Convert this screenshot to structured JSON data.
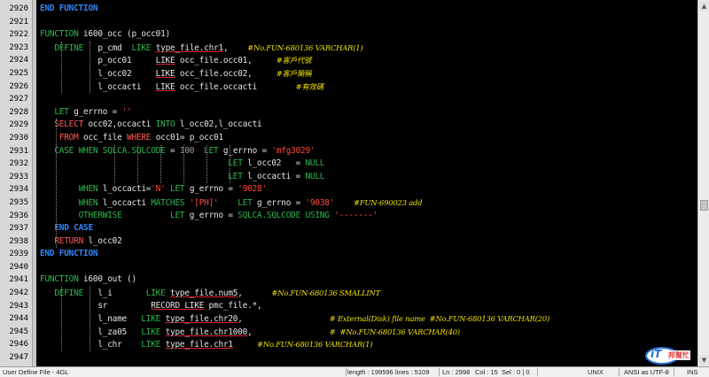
{
  "lines": [
    {
      "n": "2920",
      "segs": [
        {
          "c": "kw",
          "t": "END FUNCTION"
        }
      ]
    },
    {
      "n": "2921",
      "segs": []
    },
    {
      "n": "2922",
      "segs": [
        {
          "c": "kw2",
          "t": "FUNCTION "
        },
        {
          "c": "id",
          "t": "i600_occ (p_occ01)"
        }
      ]
    },
    {
      "n": "2923",
      "segs": [
        {
          "c": "id",
          "t": "   "
        },
        {
          "c": "kw2",
          "t": "DEFINE"
        },
        {
          "c": "id",
          "t": "   p_cmd  "
        },
        {
          "c": "kw2",
          "t": "LIKE "
        },
        {
          "c": "ul",
          "t": "type_file.chr1"
        },
        {
          "c": "id",
          "t": ",    "
        },
        {
          "c": "cm",
          "t": "#No.FUN-680136 VARCHAR(1)"
        }
      ]
    },
    {
      "n": "2924",
      "segs": [
        {
          "c": "id",
          "t": "            p_occ01     "
        },
        {
          "c": "ul",
          "t": "LIKE"
        },
        {
          "c": "id",
          "t": " occ_file.occ01,     "
        },
        {
          "c": "cm",
          "t": "#客戶代號"
        }
      ]
    },
    {
      "n": "2925",
      "segs": [
        {
          "c": "id",
          "t": "            l_occ02     "
        },
        {
          "c": "ul",
          "t": "LIKE"
        },
        {
          "c": "id",
          "t": " occ_file.occ02,     "
        },
        {
          "c": "cm",
          "t": "#客戶簡稱"
        }
      ]
    },
    {
      "n": "2926",
      "segs": [
        {
          "c": "id",
          "t": "            l_occacti   "
        },
        {
          "c": "ul",
          "t": "LIKE"
        },
        {
          "c": "id",
          "t": " occ_file.occacti        "
        },
        {
          "c": "cm",
          "t": "#有效碼"
        }
      ]
    },
    {
      "n": "2927",
      "segs": []
    },
    {
      "n": "2928",
      "segs": [
        {
          "c": "id",
          "t": "   "
        },
        {
          "c": "kw2",
          "t": "LET"
        },
        {
          "c": "id",
          "t": " g_errno = "
        },
        {
          "c": "str",
          "t": "''"
        }
      ]
    },
    {
      "n": "2929",
      "segs": [
        {
          "c": "id",
          "t": "   "
        },
        {
          "c": "kw3",
          "t": "SELECT"
        },
        {
          "c": "id",
          "t": " occ02,occacti "
        },
        {
          "c": "kw2",
          "t": "INTO"
        },
        {
          "c": "id",
          "t": " l_occ02,l_occacti"
        }
      ]
    },
    {
      "n": "2930",
      "segs": [
        {
          "c": "id",
          "t": "    "
        },
        {
          "c": "kw3",
          "t": "FROM"
        },
        {
          "c": "id",
          "t": " occ_file "
        },
        {
          "c": "kw3",
          "t": "WHERE"
        },
        {
          "c": "id",
          "t": " occ01= p_occ01"
        }
      ]
    },
    {
      "n": "2931",
      "segs": [
        {
          "c": "id",
          "t": "   "
        },
        {
          "c": "kw2",
          "t": "CASE WHEN SQLCA.SQLCODE"
        },
        {
          "c": "id",
          "t": " = "
        },
        {
          "c": "num",
          "t": "100"
        },
        {
          "c": "id",
          "t": "  "
        },
        {
          "c": "kw2",
          "t": "LET"
        },
        {
          "c": "id",
          "t": " g_errno = "
        },
        {
          "c": "str",
          "t": "'mfg3029'"
        }
      ]
    },
    {
      "n": "2932",
      "segs": [
        {
          "c": "id",
          "t": "                                       "
        },
        {
          "c": "kw2",
          "t": "LET"
        },
        {
          "c": "id",
          "t": " l_occ02   = "
        },
        {
          "c": "kw2",
          "t": "NULL"
        }
      ]
    },
    {
      "n": "2933",
      "segs": [
        {
          "c": "id",
          "t": "                                       "
        },
        {
          "c": "kw2",
          "t": "LET"
        },
        {
          "c": "id",
          "t": " l_occacti = "
        },
        {
          "c": "kw2",
          "t": "NULL"
        }
      ]
    },
    {
      "n": "2934",
      "segs": [
        {
          "c": "id",
          "t": "        "
        },
        {
          "c": "kw2",
          "t": "WHEN"
        },
        {
          "c": "id",
          "t": " l_occacti="
        },
        {
          "c": "str",
          "t": "'N'"
        },
        {
          "c": "id",
          "t": " "
        },
        {
          "c": "kw2",
          "t": "LET"
        },
        {
          "c": "id",
          "t": " g_errno = "
        },
        {
          "c": "str",
          "t": "'9028'"
        }
      ]
    },
    {
      "n": "2935",
      "segs": [
        {
          "c": "id",
          "t": "        "
        },
        {
          "c": "kw2",
          "t": "WHEN"
        },
        {
          "c": "id",
          "t": " l_occacti "
        },
        {
          "c": "kw2",
          "t": "MATCHES"
        },
        {
          "c": "id",
          "t": " "
        },
        {
          "c": "str",
          "t": "'[PH]'"
        },
        {
          "c": "id",
          "t": "    "
        },
        {
          "c": "kw2",
          "t": "LET"
        },
        {
          "c": "id",
          "t": " g_errno = "
        },
        {
          "c": "str",
          "t": "'9038'"
        },
        {
          "c": "id",
          "t": "    "
        },
        {
          "c": "cm",
          "t": "#FUN-690023 add"
        }
      ]
    },
    {
      "n": "2936",
      "segs": [
        {
          "c": "id",
          "t": "        "
        },
        {
          "c": "kw2",
          "t": "OTHERWISE"
        },
        {
          "c": "id",
          "t": "          "
        },
        {
          "c": "kw2",
          "t": "LET"
        },
        {
          "c": "id",
          "t": " g_errno = "
        },
        {
          "c": "kw2",
          "t": "SQLCA.SQLCODE USING"
        },
        {
          "c": "id",
          "t": " "
        },
        {
          "c": "str",
          "t": "'-------'"
        }
      ]
    },
    {
      "n": "2937",
      "segs": [
        {
          "c": "id",
          "t": "   "
        },
        {
          "c": "kw",
          "t": "END CASE"
        }
      ]
    },
    {
      "n": "2938",
      "segs": [
        {
          "c": "id",
          "t": "   "
        },
        {
          "c": "kw3",
          "t": "RETURN"
        },
        {
          "c": "id",
          "t": " l_occ02"
        }
      ]
    },
    {
      "n": "2939",
      "segs": [
        {
          "c": "kw",
          "t": "END FUNCTION"
        }
      ]
    },
    {
      "n": "2940",
      "segs": []
    },
    {
      "n": "2941",
      "segs": [
        {
          "c": "kw2",
          "t": "FUNCTION "
        },
        {
          "c": "id",
          "t": "i600_out ()"
        }
      ]
    },
    {
      "n": "2942",
      "segs": [
        {
          "c": "id",
          "t": "   "
        },
        {
          "c": "kw2",
          "t": "DEFINE"
        },
        {
          "c": "id",
          "t": "   l_i       "
        },
        {
          "c": "kw2",
          "t": "LIKE "
        },
        {
          "c": "ul",
          "t": "type_file.num5"
        },
        {
          "c": "id",
          "t": ",      "
        },
        {
          "c": "cm",
          "t": "#No.FUN-680136 SMALLINT"
        }
      ]
    },
    {
      "n": "2943",
      "segs": [
        {
          "c": "id",
          "t": "            sr         "
        },
        {
          "c": "ul",
          "t": "RECORD LIKE"
        },
        {
          "c": "id",
          "t": " pmc_file.*,"
        }
      ]
    },
    {
      "n": "2944",
      "segs": [
        {
          "c": "id",
          "t": "            l_name   "
        },
        {
          "c": "kw2",
          "t": "LIKE "
        },
        {
          "c": "ul",
          "t": "type_file.chr20"
        },
        {
          "c": "id",
          "t": ",                  "
        },
        {
          "c": "cm",
          "t": "# External(Disk) file name  #No.FUN-680136 VARCHAR(20)"
        }
      ]
    },
    {
      "n": "2945",
      "segs": [
        {
          "c": "id",
          "t": "            l_za05   "
        },
        {
          "c": "kw2",
          "t": "LIKE "
        },
        {
          "c": "ul",
          "t": "type_file.chr1000"
        },
        {
          "c": "id",
          "t": ",                "
        },
        {
          "c": "cm",
          "t": "#  #No.FUN-680136 VARCHAR(40)"
        }
      ]
    },
    {
      "n": "2946",
      "segs": [
        {
          "c": "id",
          "t": "            l_chr    "
        },
        {
          "c": "kw2",
          "t": "LIKE "
        },
        {
          "c": "ul",
          "t": "type_file.chr1"
        },
        {
          "c": "id",
          "t": "     "
        },
        {
          "c": "cm",
          "t": "#No.FUN-680136 VARCHAR(1)"
        }
      ]
    },
    {
      "n": "2947",
      "segs": []
    }
  ],
  "status": {
    "file_type": "User Define File - 4GL",
    "length": "length : 199596",
    "lines": "lines : 5109",
    "ln": "Ln : 2998",
    "col": "Col : 15",
    "sel": "Sel : 0 | 0",
    "eol": "UNIX",
    "encoding": "ANSI as UTF-8",
    "mode": "INS"
  },
  "logo": {
    "main": "iT",
    "sub": "邦幫忙"
  },
  "colors": {
    "keyword": "#2f86ff",
    "keyword_green": "#2fb84e",
    "keyword_red": "#ff5a5a",
    "string": "#ff4a3a",
    "comment": "#f0e000"
  }
}
